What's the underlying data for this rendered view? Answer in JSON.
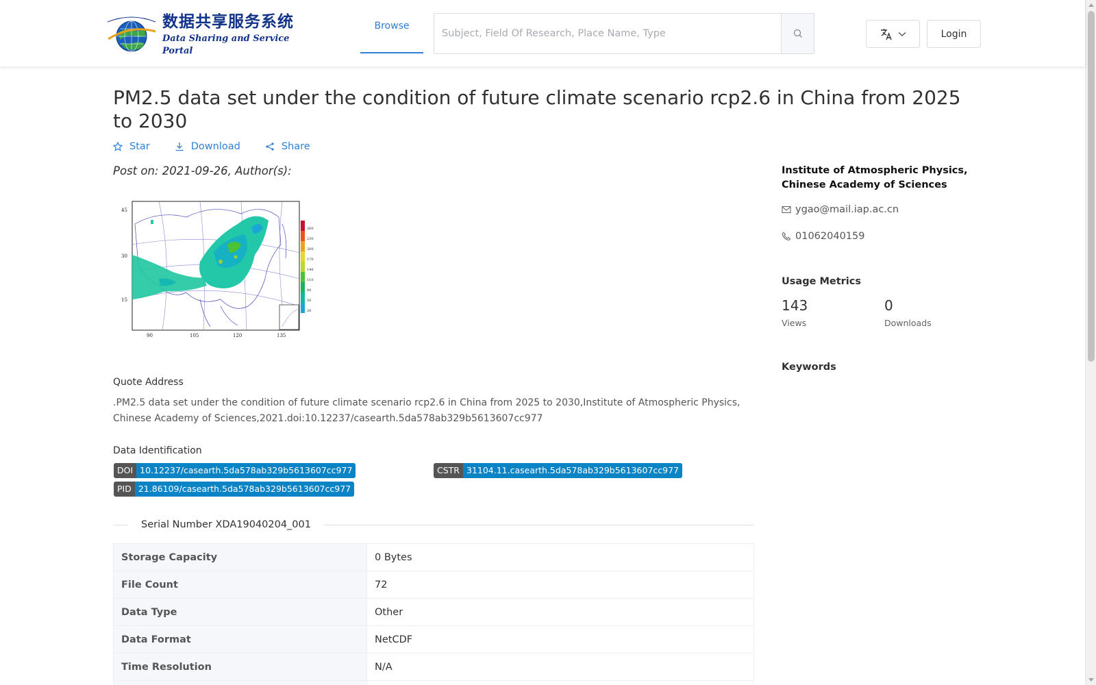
{
  "header": {
    "logo_cn": "数据共享服务系统",
    "logo_en": "Data Sharing and Service Portal",
    "nav_browse": "Browse",
    "search_placeholder": "Subject, Field Of Research, Place Name, Type",
    "login_label": "Login"
  },
  "dataset": {
    "title": "PM2.5 data set under the condition of future climate scenario rcp2.6 in China from 2025 to 2030",
    "actions": {
      "star": "Star",
      "download": "Download",
      "share": "Share"
    },
    "post_line": "Post on: 2021-09-26, Author(s):",
    "thumbnail": {
      "y_ticks": [
        "45",
        "30",
        "15"
      ],
      "x_ticks": [
        "90",
        "105",
        "120",
        "135"
      ],
      "legend_ticks": [
        "260",
        "230",
        "200",
        "170",
        "140",
        "110",
        "80",
        "50",
        "20"
      ],
      "legend_colors": [
        "#c8102e",
        "#e8541b",
        "#f0a020",
        "#e6d82a",
        "#b6d92a",
        "#4cc234",
        "#17b45a",
        "#16b7a0",
        "#1aa6d6"
      ]
    },
    "quote": {
      "heading": "Quote Address",
      "text": ".PM2.5 data set under the condition of future climate scenario rcp2.6 in China from 2025 to 2030,Institute of Atmospheric Physics, Chinese Academy of Sciences,2021.doi:10.12237/casearth.5da578ab329b5613607cc977"
    },
    "identification": {
      "heading": "Data Identification",
      "doi_key": "DOI",
      "doi_value": "10.12237/casearth.5da578ab329b5613607cc977",
      "cstr_key": "CSTR",
      "cstr_value": "31104.11.casearth.5da578ab329b5613607cc977",
      "pid_key": "PID",
      "pid_value": "21.86109/casearth.5da578ab329b5613607cc977"
    },
    "serial_number": "Serial Number XDA19040204_001",
    "details": [
      {
        "label": "Storage Capacity",
        "value": "0 Bytes"
      },
      {
        "label": "File Count",
        "value": "72"
      },
      {
        "label": "Data Type",
        "value": "Other"
      },
      {
        "label": "Data Format",
        "value": "NetCDF"
      },
      {
        "label": "Time Resolution",
        "value": "N/A"
      },
      {
        "label": "",
        "value": ""
      }
    ]
  },
  "sidebar": {
    "institution": "Institute of Atmospheric Physics, Chinese Academy of Sciences",
    "email": "ygao@mail.iap.ac.cn",
    "phone": "01062040159",
    "usage_heading": "Usage Metrics",
    "views_count": "143",
    "views_label": "Views",
    "downloads_count": "0",
    "downloads_label": "Downloads",
    "keywords_heading": "Keywords"
  },
  "colors": {
    "accent": "#2e7fd6",
    "badge_key": "#555555",
    "badge_value": "#0b84c6",
    "logo_blue": "#12338a"
  }
}
